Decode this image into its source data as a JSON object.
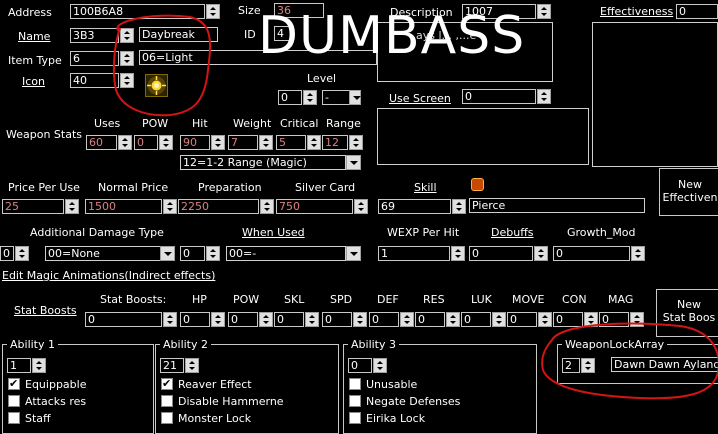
{
  "labels": {
    "address": "Address",
    "name": "Name",
    "item_type": "Item Type",
    "icon": "Icon",
    "size": "Size",
    "id": "ID",
    "description": "Description",
    "effectiveness": "Effectiveness",
    "level": "Level",
    "use_screen": "Use Screen",
    "weapon_stats": "Weapon Stats",
    "uses": "Uses",
    "pow": "POW",
    "hit": "Hit",
    "weight": "Weight",
    "critical": "Critical",
    "range": "Range",
    "price_per_use": "Price Per Use",
    "normal_price": "Normal Price",
    "preparation": "Preparation",
    "silver_card": "Silver Card",
    "skill": "Skill",
    "additional_damage_type": "Additional Damage Type",
    "when_used": "When Used",
    "wexp_per_hit": "WEXP Per Hit",
    "debuffs": "Debuffs",
    "growth_mod": "Growth_Mod",
    "edit_magic_animations": "Edit Magic Animations(Indirect effects)",
    "stat_boosts_link": "Stat Boosts",
    "stat_boosts_row": "Stat Boosts:",
    "hp": "HP",
    "pow2": "POW",
    "skl": "SKL",
    "spd": "SPD",
    "def": "DEF",
    "res": "RES",
    "luk": "LUK",
    "move": "MOVE",
    "con": "CON",
    "mag": "MAG",
    "new_effectiveness": "New\nEffectiven",
    "new_stat_boosts": "New\nStat Boos",
    "ability1": "Ability 1",
    "ability2": "Ability 2",
    "ability3": "Ability 3",
    "weapon_lock_array": "WeaponLockArray",
    "overlay_text": "DUMBASS"
  },
  "values": {
    "address": "100B6A8",
    "size": "36",
    "name_id": "3B3",
    "name_text": "Daybreak",
    "id_val": "4",
    "description": "1007",
    "effectiveness": "0",
    "item_type": "6",
    "item_type_text": "06=Light",
    "icon": "40",
    "level_num": "0",
    "level_rank": "-",
    "use_screen": "0",
    "uses": "60",
    "pow": "0",
    "hit": "90",
    "weight": "7",
    "critical": "5",
    "range": "12",
    "range_text": "12=1-2 Range (Magic)",
    "price_per_use": "25",
    "normal_price": "1500",
    "preparation": "2250",
    "silver_card": "750",
    "skill_num": "69",
    "skill_text": "Pierce",
    "add_damage_num": "0",
    "add_damage_text": "00=None",
    "when_used_num": "0",
    "when_used_text": "00=-",
    "wexp": "1",
    "debuffs": "0",
    "growth_mod": "0",
    "stat_boosts": "0",
    "hp": "0",
    "skl": "0",
    "spd": "0",
    "def": "0",
    "res": "0",
    "luk": "0",
    "move": "0",
    "con": "0",
    "mag": "0",
    "ability1": "1",
    "ability2": "21",
    "ability3": "0",
    "weapon_lock_num": "2",
    "weapon_lock_text": "Dawn Dawn Aylanda",
    "desc_partial": "ays l... ,...e"
  },
  "ability1_items": [
    {
      "label": "Equippable",
      "checked": true
    },
    {
      "label": "Attacks res",
      "checked": false
    },
    {
      "label": "Staff",
      "checked": false
    }
  ],
  "ability2_items": [
    {
      "label": "Reaver Effect",
      "checked": true
    },
    {
      "label": "Disable Hammerne",
      "checked": false
    },
    {
      "label": "Monster Lock",
      "checked": false
    }
  ],
  "ability3_items": [
    {
      "label": "Unusable",
      "checked": false
    },
    {
      "label": "Negate Defenses",
      "checked": false
    },
    {
      "label": "Eirika Lock",
      "checked": false
    }
  ],
  "colors": {
    "background": "#000000",
    "annotation": "#d21414",
    "pink_text": "#d98080",
    "text": "#ffffff"
  }
}
